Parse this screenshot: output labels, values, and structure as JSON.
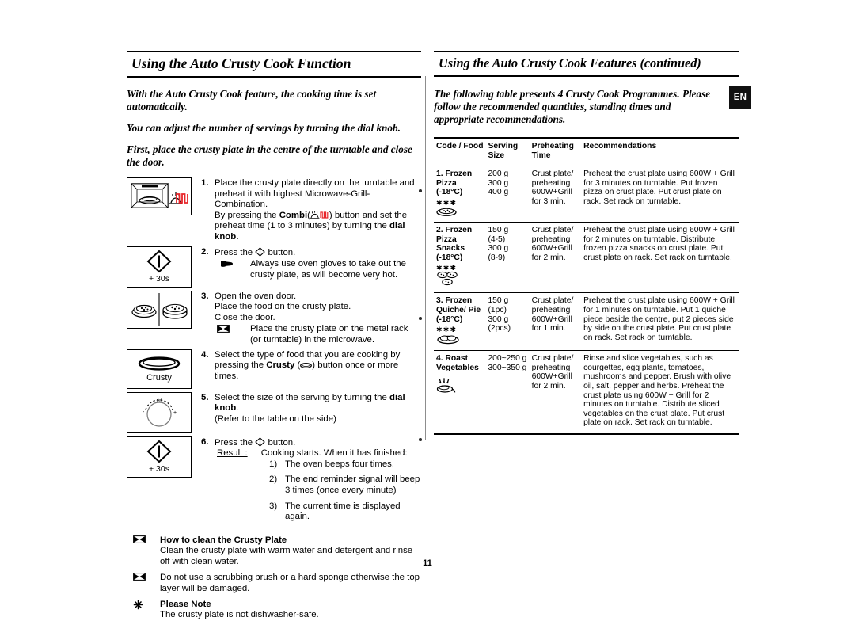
{
  "page": {
    "number": "11",
    "language_badge": "EN"
  },
  "left": {
    "heading": "Using the Auto Crusty Cook Function",
    "intro": [
      "With the Auto Crusty Cook feature, the cooking time is set automatically.",
      "You can adjust the number of servings by turning the dial knob.",
      "First, place the crusty plate in the centre of the turntable and close the door."
    ],
    "steps": [
      {
        "num": "1.",
        "figure": "microwave-oven-grill-icon",
        "figure_caption": "",
        "lines": [
          "Place the crusty plate directly on the turntable and preheat it with highest Microwave-Grill-Combination.",
          "By pressing the Combi( ) button and set the preheat time (1 to 3 minutes) by  turning the dial knob."
        ],
        "bold_terms": [
          "Combi",
          "dial knob."
        ]
      },
      {
        "num": "2.",
        "figure": "start-plus-30s-button-icon",
        "figure_caption": "+ 30s",
        "lines": [
          "Press the   button."
        ],
        "note_icon": "pointing-hand-icon",
        "note": "Always use oven gloves to take out the crusty plate, as will become very hot."
      },
      {
        "num": "3.",
        "figure": "crusty-plate-with-food-icon",
        "figure_caption": "",
        "lines": [
          "Open the oven door.",
          "Place the food on the crusty plate.",
          "Close the door."
        ],
        "note_icon": "note-marker-icon",
        "note": "Place the crusty plate on the metal rack (or turntable) in the microwave."
      },
      {
        "num": "4.",
        "figure": "crusty-button-icon",
        "figure_caption": "Crusty",
        "lines": [
          "Select the type of food that you are cooking by pressing the Crusty ( ) button once or more times."
        ],
        "bold_terms": [
          "Crusty"
        ]
      },
      {
        "num": "5.",
        "figure": "dial-knob-icon",
        "figure_caption": "",
        "lines": [
          "Select the size of the serving by turning the dial knob.",
          "(Refer to the table on the side)"
        ],
        "bold_terms": [
          "dial knob"
        ]
      },
      {
        "num": "6.",
        "figure": "start-plus-30s-button-icon",
        "figure_caption": "+ 30s",
        "lines": [
          "Press the   button."
        ],
        "result_label": "Result :",
        "result_text": "Cooking starts. When it has finished:",
        "result_items": [
          {
            "n": "1)",
            "t": "The oven beeps four times."
          },
          {
            "n": "2)",
            "t": "The end reminder signal will beep 3 times (once every minute)"
          },
          {
            "n": "3)",
            "t": "The current time is displayed again."
          }
        ]
      }
    ],
    "clean": {
      "heading": "How to clean the Crusty Plate",
      "heading_icon": "note-marker-icon",
      "body": "Clean the crusty plate with warm water and detergent and rinse off with clean water.",
      "warn_icon": "note-marker-icon",
      "warn": "Do not use a scrubbing brush or a hard sponge otherwise the top layer will be damaged.",
      "note_icon": "snowflake-icon",
      "note_heading": "Please Note",
      "note_body": "The crusty plate is not dishwasher-safe."
    }
  },
  "right": {
    "heading": "Using the Auto Crusty Cook Features (continued)",
    "intro": "The following table presents 4 Crusty Cook Programmes. Please follow the recommended quantities, standing times and appropriate recommendations.",
    "table": {
      "headers": [
        "Code / Food",
        "Serving Size",
        "Preheating Time",
        "Recommendations"
      ],
      "rows": [
        {
          "code": "1. Frozen Pizza (-18°C)",
          "code_lines": [
            "1. Frozen",
            "Pizza",
            "(-18°C)"
          ],
          "icon": "frozen-pizza-icon",
          "stars": "✱✱✱",
          "serving": "200 g\n300 g\n400 g",
          "serving_lines": [
            "200 g",
            "300 g",
            "400 g"
          ],
          "preheating": "Crust plate/ preheating 600W+Grill for 3 min.",
          "preheating_lines": [
            "Crust plate/",
            "preheating",
            "600W+Grill",
            "for 3 min."
          ],
          "recommendations": "Preheat the crust plate using 600W + Grill for 3 minutes on turntable. Put frozen pizza on crust plate. Put crust plate on rack. Set rack on turntable."
        },
        {
          "code": "2. Frozen Pizza Snacks (-18°C)",
          "code_lines": [
            "2. Frozen",
            "Pizza",
            "Snacks",
            "(-18°C)"
          ],
          "icon": "frozen-pizza-snacks-icon",
          "stars": "✱✱✱",
          "serving_lines": [
            "150 g",
            "(4-5)",
            "300 g",
            "(8-9)"
          ],
          "preheating_lines": [
            "Crust plate/",
            "preheating",
            "600W+Grill",
            "for 2 min."
          ],
          "recommendations": "Preheat the crust plate using 600W + Grill for 2 minutes on turntable. Distribute frozen pizza snacks on crust plate. Put crust plate on rack. Set rack on turntable."
        },
        {
          "code": "3. Frozen Quiche/ Pie (-18°C)",
          "code_lines": [
            "3. Frozen",
            "Quiche/ Pie",
            "(-18°C)"
          ],
          "icon": "frozen-quiche-pie-icon",
          "stars": "✱✱✱",
          "serving_lines": [
            "150 g",
            "(1pc)",
            "300 g",
            "(2pcs)"
          ],
          "preheating_lines": [
            "Crust plate/",
            "preheating",
            "600W+Grill",
            "for 1 min."
          ],
          "recommendations": "Preheat the crust plate using 600W + Grill for 1 minutes on turntable. Put 1 quiche piece beside the centre, put 2 pieces side by side on the crust plate. Put crust plate on rack. Set rack on turntable."
        },
        {
          "code": "4. Roast Vegetables",
          "code_lines": [
            "4. Roast",
            "Vegetables"
          ],
          "icon": "roast-vegetables-icon",
          "stars": "",
          "serving_lines": [
            "200~250 g",
            "300~350 g"
          ],
          "preheating_lines": [
            "Crust plate/",
            "preheating",
            "600W+Grill",
            "for 2 min."
          ],
          "recommendations": "Rinse and slice vegetables, such as courgettes, egg plants, tomatoes, mushrooms and pepper. Brush with olive oil, salt, pepper and herbs. Preheat the crust plate using 600W + Grill for 2 minutes on turntable. Distribute sliced vegetables on the crust plate. Put crust plate on rack. Set rack on turntable."
        }
      ]
    }
  },
  "colors": {
    "ink": "#000000",
    "rule": "#8d8d8d",
    "accent_red": "#e8252a",
    "badge_bg": "#111111"
  }
}
